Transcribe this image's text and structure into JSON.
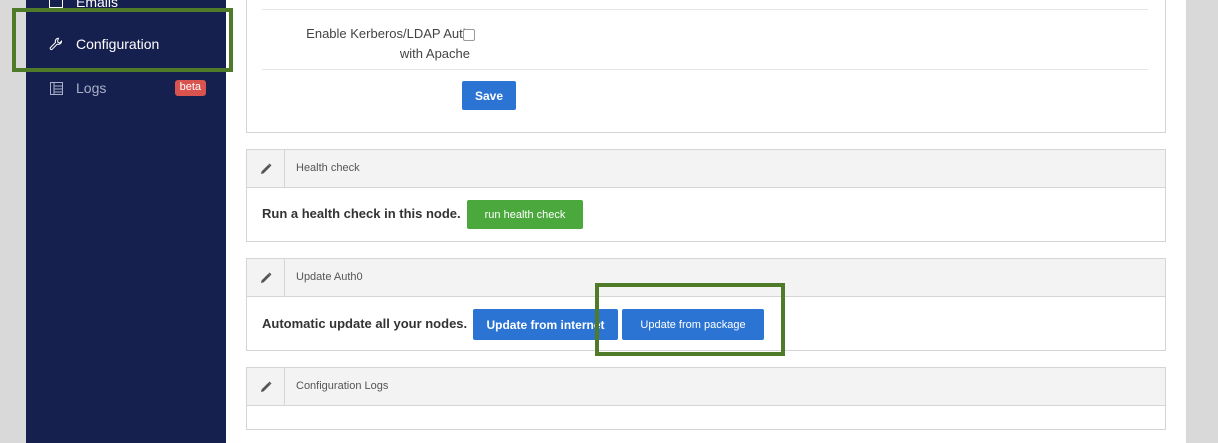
{
  "sidebar": {
    "items": [
      {
        "label": "Emails",
        "icon": "mail-icon"
      },
      {
        "label": "Configuration",
        "icon": "wrench-icon"
      },
      {
        "label": "Logs",
        "icon": "logs-icon",
        "badge": "beta"
      }
    ]
  },
  "settings": {
    "kerberos_label_line1": "Enable Kerberos/LDAP Auth",
    "kerberos_label_line2": "with Apache",
    "kerberos_checked": false,
    "save_label": "Save"
  },
  "health_check": {
    "title": "Health check",
    "text": "Run a health check in this node.",
    "button_label": "run health check"
  },
  "update_auth0": {
    "title": "Update Auth0",
    "text": "Automatic update all your nodes.",
    "internet_button_label": "Update from internet",
    "package_button_label": "Update from package"
  },
  "config_logs": {
    "title": "Configuration Logs"
  },
  "colors": {
    "sidebar_bg": "#16204f",
    "primary": "#2b74d3",
    "success": "#4aa83c",
    "badge": "#d9534f",
    "highlight": "#4f7a28"
  }
}
